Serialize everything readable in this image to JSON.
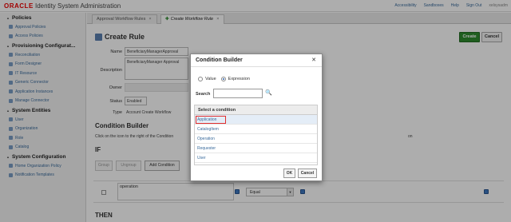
{
  "header": {
    "logo": "ORACLE",
    "app_title": "Identity System Administration",
    "nav": [
      "Accessibility",
      "Sandboxes",
      "Help",
      "Sign Out"
    ],
    "user": "xelsysadm"
  },
  "sidebar": {
    "sections": [
      {
        "title": "Policies",
        "items": [
          "Approval Policies",
          "Access Policies"
        ]
      },
      {
        "title": "Provisioning Configurat...",
        "items": [
          "Reconciliation",
          "Form Designer",
          "IT Resource",
          "Generic Connector",
          "Application Instances",
          "Manage Connector"
        ]
      },
      {
        "title": "System Entities",
        "items": [
          "User",
          "Organization",
          "Role",
          "Catalog"
        ]
      },
      {
        "title": "System Configuration",
        "items": [
          "Home Organization Policy",
          "Notification Templates"
        ]
      }
    ]
  },
  "tabs": [
    {
      "label": "Approval Workflow Rules"
    },
    {
      "label": "Create Workflow Rule"
    }
  ],
  "main": {
    "title": "Create Rule",
    "create_label": "Create",
    "cancel_label": "Cancel",
    "fields": {
      "name_label": "Name",
      "name_value": "BeneficiaryManagerApproval",
      "description_label": "Description",
      "description_value": "BeneficiaryManager Approval",
      "owner_label": "Owner",
      "status_label": "Status",
      "status_value": "Enabled",
      "type_label": "Type",
      "type_value": "Account Create Workflow"
    },
    "condition_builder_title": "Condition Builder",
    "condition_help": "Click on the icon to the right of the Condition",
    "condition_help_tail": "on",
    "if_title": "IF",
    "toolbar": {
      "group": "Group",
      "ungroup": "Ungroup",
      "add_condition": "Add Condition"
    },
    "condition": {
      "text": "operation",
      "operator": "Equal"
    },
    "then_title": "THEN"
  },
  "dialog": {
    "title": "Condition Builder",
    "radio_value": "Value",
    "radio_expression": "Expression",
    "search_label": "Search",
    "search_value": "",
    "list_header": "Select a condition",
    "items": [
      "Application",
      "CatalogItem",
      "Operation",
      "Requester",
      "User"
    ],
    "ok": "OK",
    "cancel": "Cancel"
  },
  "colors": {
    "accent": "#2f8b2f",
    "link": "#3a6b9c",
    "selection": "#e03030"
  }
}
